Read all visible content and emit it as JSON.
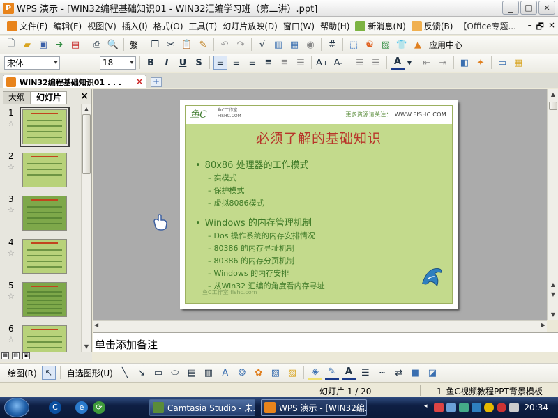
{
  "window": {
    "title": "WPS 演示 - [WIN32编程基础知识01 - WIN32汇编学习班（第二讲）.ppt]",
    "controls": [
      "_",
      "□",
      "×"
    ]
  },
  "menu": {
    "items": [
      "文件(F)",
      "编辑(E)",
      "视图(V)",
      "插入(I)",
      "格式(O)",
      "工具(T)",
      "幻灯片放映(D)",
      "窗口(W)",
      "帮助(H)",
      "新消息(N)",
      "反馈(B)",
      "【Office专题..."
    ],
    "right_controls": [
      "–",
      "🗗",
      "×"
    ]
  },
  "toolbar1": {
    "app_center_label": "应用中心",
    "traditional_label": "繁"
  },
  "toolbar2": {
    "font_name": "宋体",
    "font_size": "18",
    "bold_label": "B",
    "italic_label": "I",
    "underline_label": "U",
    "shadow_label": "S"
  },
  "tabbar": {
    "doc_tab_label": "WIN32编程基础知识01 . . .",
    "close_label": "×",
    "add_label": "+"
  },
  "left_panel": {
    "tab_outline": "大纲",
    "tab_slides": "幻灯片",
    "close_label": "×",
    "thumbnails": [
      {
        "number": "1",
        "star": "☆"
      },
      {
        "number": "2",
        "star": "☆"
      },
      {
        "number": "3",
        "star": "☆"
      },
      {
        "number": "4",
        "star": "☆"
      },
      {
        "number": "5",
        "star": "☆"
      },
      {
        "number": "6",
        "star": "☆"
      }
    ]
  },
  "slide": {
    "logo_text": "鱼C",
    "logo_sub": "鱼C工作室\nFISHC.COM",
    "site_label": "更多资源请关注：",
    "site_url": "WWW.FISHC.COM",
    "title": "必须了解的基础知识",
    "bullets": [
      {
        "text": "80x86 处理器的工作模式",
        "children": [
          "实模式",
          "保护模式",
          "虚拟8086模式"
        ]
      },
      {
        "text": "Windows 的内存管理机制",
        "children": [
          "Dos 操作系统的内存安排情况",
          "80386 的内存寻址机制",
          "80386 的内存分页机制",
          "Windows 的内存安排",
          "从Win32 汇编的角度看内存寻址"
        ]
      }
    ],
    "watermark": "鱼C工作室 fishc.com"
  },
  "notes": {
    "placeholder": "单击添加备注"
  },
  "drawbar": {
    "draw_label": "绘图(R)",
    "autoshape_label": "自选图形(U)"
  },
  "status": {
    "slide_info": "幻灯片 1 / 20",
    "template": "1_鱼C视频教程PPT背景模板"
  },
  "taskbar": {
    "tasks": [
      {
        "label": "Camtasia Studio - 未..."
      },
      {
        "label": "WPS 演示 - [WIN32编..."
      }
    ],
    "clock": "20:34"
  },
  "colors": {
    "slide_bg": "#C3DA8C",
    "title_red": "#B8352A",
    "bullet_green": "#3E7A27",
    "canvas_gray": "#ABABAB"
  }
}
